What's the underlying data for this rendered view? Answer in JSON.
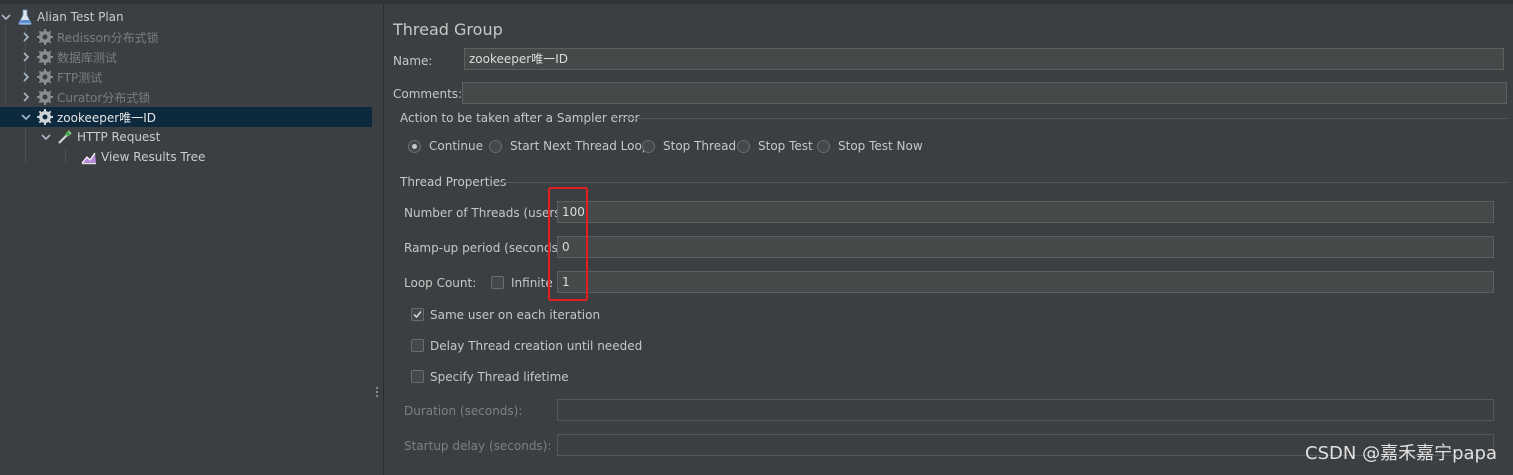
{
  "tree": {
    "items": [
      {
        "label": "Alian Test Plan",
        "icon": "test-plan-icon"
      },
      {
        "label": "Redisson分布式锁",
        "icon": "thread-group-gear-icon",
        "disabled": true
      },
      {
        "label": "数据库测试",
        "icon": "thread-group-gear-icon",
        "disabled": true
      },
      {
        "label": "FTP测试",
        "icon": "thread-group-gear-icon",
        "disabled": true
      },
      {
        "label": "Curator分布式锁",
        "icon": "thread-group-gear-icon",
        "disabled": true
      },
      {
        "label": "zookeeper唯一ID",
        "icon": "thread-group-gear-icon",
        "selected": true
      },
      {
        "label": "HTTP Request",
        "icon": "http-sampler-pipette-icon"
      },
      {
        "label": "View Results Tree",
        "icon": "results-tree-icon"
      }
    ]
  },
  "panel": {
    "title": "Thread Group",
    "name_label": "Name:",
    "name_value": "zookeeper唯一ID",
    "comments_label": "Comments:",
    "comments_value": "",
    "sampler_error": {
      "legend": "Action to be taken after a Sampler error",
      "options": [
        "Continue",
        "Start Next Thread Loop",
        "Stop Thread",
        "Stop Test",
        "Stop Test Now"
      ],
      "selected": "Continue"
    },
    "thread_props": {
      "legend": "Thread Properties",
      "threads_label": "Number of Threads (users):",
      "threads_value": "100",
      "rampup_label": "Ramp-up period (seconds):",
      "rampup_value": "0",
      "loop_label": "Loop Count:",
      "infinite_label": "Infinite",
      "infinite_checked": false,
      "loop_value": "1",
      "same_user_label": "Same user on each iteration",
      "same_user_checked": true,
      "delay_label": "Delay Thread creation until needed",
      "delay_checked": false,
      "lifetime_label": "Specify Thread lifetime",
      "lifetime_checked": false,
      "duration_label": "Duration (seconds):",
      "duration_value": "",
      "startup_label": "Startup delay (seconds):",
      "startup_value": ""
    }
  },
  "watermark": "CSDN @嘉禾嘉宁papa",
  "colors": {
    "background": "#3c3f41",
    "selection": "#0d293e",
    "highlight_box": "#e02020"
  }
}
